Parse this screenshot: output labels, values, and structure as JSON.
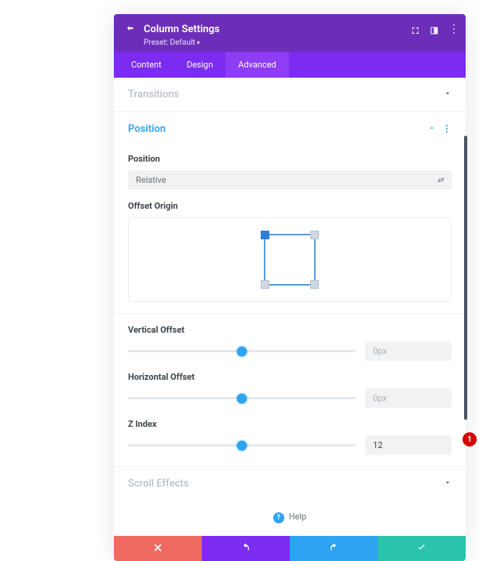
{
  "header": {
    "title": "Column Settings",
    "preset_label": "Preset: Default"
  },
  "tabs": {
    "content": "Content",
    "design": "Design",
    "advanced": "Advanced"
  },
  "sections": {
    "transitions": "Transitions",
    "position": "Position",
    "scroll_effects": "Scroll Effects"
  },
  "position": {
    "position_label": "Position",
    "position_value": "Relative",
    "offset_origin_label": "Offset Origin",
    "vertical_offset_label": "Vertical Offset",
    "vertical_offset_value": "0px",
    "horizontal_offset_label": "Horizontal Offset",
    "horizontal_offset_value": "0px",
    "z_index_label": "Z Index",
    "z_index_value": "12"
  },
  "help_label": "Help",
  "badge_text": "1"
}
